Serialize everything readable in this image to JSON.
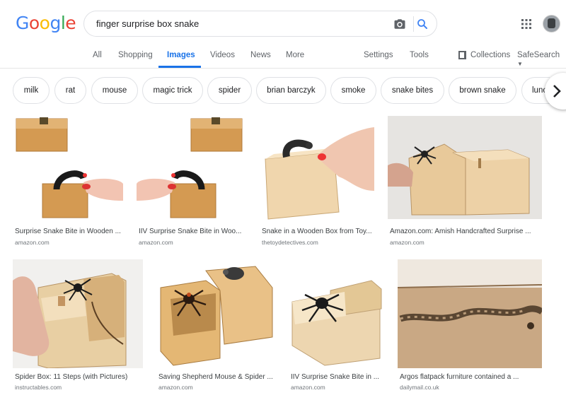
{
  "header": {
    "logo_letters": [
      "G",
      "o",
      "o",
      "g",
      "l",
      "e"
    ],
    "logo_colors": [
      "#4285f4",
      "#ea4335",
      "#fbbc05",
      "#4285f4",
      "#34a853",
      "#ea4335"
    ],
    "query": "finger surprise box snake"
  },
  "tabs": {
    "all": "All",
    "shopping": "Shopping",
    "images": "Images",
    "videos": "Videos",
    "news": "News",
    "more": "More",
    "settings": "Settings",
    "tools": "Tools",
    "collections": "Collections",
    "safesearch": "SafeSearch",
    "active": "Images"
  },
  "chips": [
    "milk",
    "rat",
    "mouse",
    "magic trick",
    "spider",
    "brian barczyk",
    "smoke",
    "snake bites",
    "brown snake",
    "lunc"
  ],
  "results": [
    {
      "title": "Surprise Snake Bite in Wooden ...",
      "source": "amazon.com"
    },
    {
      "title": "IIV Surprise Snake Bite in Woo...",
      "source": "amazon.com"
    },
    {
      "title": "Snake in a Wooden Box from Toy...",
      "source": "thetoydetectives.com"
    },
    {
      "title": "Amazon.com: Amish Handcrafted Surprise ...",
      "source": "amazon.com"
    },
    {
      "title": "Spider Box: 11 Steps (with Pictures)",
      "source": "instructables.com"
    },
    {
      "title": "Saving Shepherd Mouse & Spider ...",
      "source": "amazon.com"
    },
    {
      "title": "IIV Surprise Snake Bite in ...",
      "source": "amazon.com"
    },
    {
      "title": "Argos flatpack furniture contained a ...",
      "source": "dailymail.co.uk"
    }
  ],
  "colors": {
    "accent": "#1a73e8",
    "wood": "#d8a262",
    "wood_light": "#e8c99a",
    "text_secondary": "#70757a"
  }
}
